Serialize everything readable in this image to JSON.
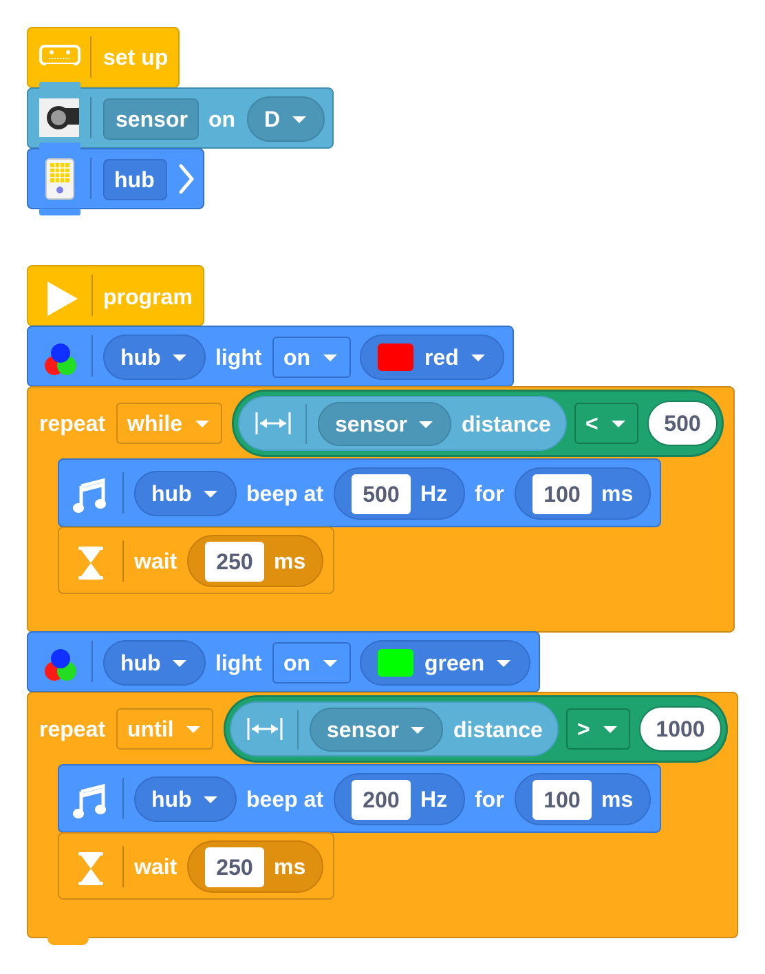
{
  "setup": {
    "hat_label": "set up",
    "sensor_label": "sensor",
    "on_label": "on",
    "port_value": "D",
    "hub_label": "hub"
  },
  "program": {
    "hat_label": "program",
    "light_red": {
      "device": "hub",
      "light_label": "light",
      "mode": "on",
      "color_name": "red",
      "color_hex": "#ff0000"
    },
    "loop1": {
      "repeat_label": "repeat",
      "mode": "while",
      "sensor": "sensor",
      "measure": "distance",
      "op": "<",
      "threshold": "500",
      "beep": {
        "device": "hub",
        "beep_label": "beep at",
        "freq": "500",
        "hz_label": "Hz",
        "for_label": "for",
        "duration": "100",
        "ms_label": "ms"
      },
      "wait": {
        "wait_label": "wait",
        "duration": "250",
        "ms_label": "ms"
      }
    },
    "light_green": {
      "device": "hub",
      "light_label": "light",
      "mode": "on",
      "color_name": "green",
      "color_hex": "#00ff00"
    },
    "loop2": {
      "repeat_label": "repeat",
      "mode": "until",
      "sensor": "sensor",
      "measure": "distance",
      "op": ">",
      "threshold": "1000",
      "beep": {
        "device": "hub",
        "beep_label": "beep at",
        "freq": "200",
        "hz_label": "Hz",
        "for_label": "for",
        "duration": "100",
        "ms_label": "ms"
      },
      "wait": {
        "wait_label": "wait",
        "duration": "250",
        "ms_label": "ms"
      }
    }
  },
  "colors": {
    "hat_yellow": "#ffbf00",
    "sensor_block": "#5cb1d6",
    "hub_blue": "#4c97ff",
    "control_orange": "#ffab19",
    "operator_green": "#1ea36f"
  },
  "icons": [
    "hub-outline-icon",
    "distance-sensor-icon",
    "hub-device-icon",
    "chevron-right-icon",
    "play-icon",
    "rgb-light-icon",
    "music-note-icon",
    "hourglass-icon",
    "distance-arrows-icon",
    "dropdown-caret-icon"
  ]
}
